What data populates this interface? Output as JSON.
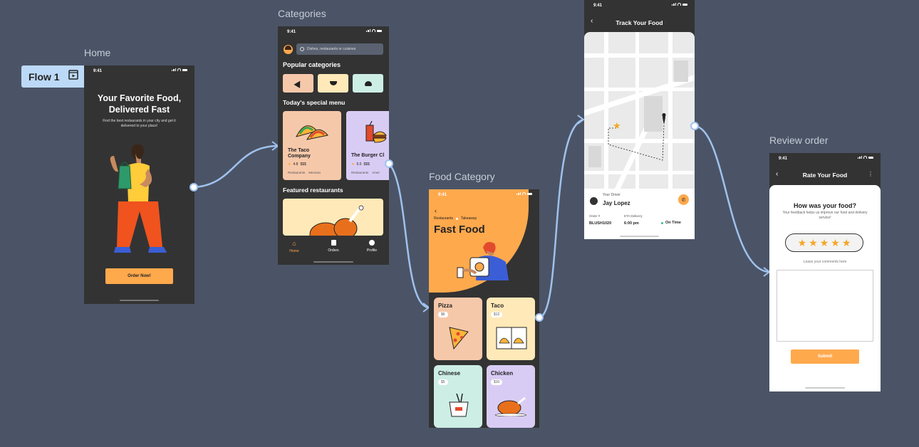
{
  "flow": {
    "label": "Flow 1"
  },
  "status_time": "9:41",
  "home": {
    "frame_label": "Home",
    "title_line1": "Your Favorite Food,",
    "title_line2": "Delivered Fast",
    "subtitle": "Find the best restaurants in your city and get it delivered to your place!",
    "cta": "Order Now!"
  },
  "categories": {
    "frame_label": "Categories",
    "search_placeholder": "Dishes, restaurants or cuisines",
    "popular_heading": "Popular categories",
    "special_heading": "Today's special menu",
    "featured_heading": "Featured restaurants",
    "cards": [
      {
        "name": "The Taco Company",
        "rating": "4.8",
        "price": "$$$",
        "tag1": "Restaurants",
        "tag2": "Mexican"
      },
      {
        "name": "The Burger Cl",
        "rating": "5.0",
        "price": "$$$",
        "tag1": "Restaurants",
        "tag2": "Amer"
      }
    ],
    "nav": [
      {
        "label": "Home"
      },
      {
        "label": "Orders"
      },
      {
        "label": "Profile"
      }
    ]
  },
  "food_category": {
    "frame_label": "Food Category",
    "breadcrumb1": "Restaurants",
    "breadcrumb2": "Takeaway",
    "title": "Fast Food",
    "tiles": [
      {
        "name": "Pizza",
        "price": "$6"
      },
      {
        "name": "Taco",
        "price": "$12"
      },
      {
        "name": "Chinese",
        "price": "$5"
      },
      {
        "name": "Chicken",
        "price": "$10"
      }
    ]
  },
  "track": {
    "title": "Track Your Food",
    "driver_label": "Your Driver",
    "driver_name": "Jay Lopez",
    "order_label": "Order #",
    "order_value": "BLUSH1020",
    "eta_label": "ETA Delivery",
    "eta_value": "6:00 pm",
    "status": "On Time"
  },
  "review": {
    "frame_label": "Review order",
    "title": "Rate Your Food",
    "question": "How was your food?",
    "helper": "Your feedback helps us improve our food and delivery service!",
    "stars": 5,
    "comment_label": "Leave your comments here",
    "submit": "Submit"
  },
  "colors": {
    "canvas": "#4b5466",
    "phone_dark": "#333333",
    "accent_orange": "#ffa94d",
    "connector": "#9fc2ee",
    "flow_chip": "#bcd9f7"
  }
}
